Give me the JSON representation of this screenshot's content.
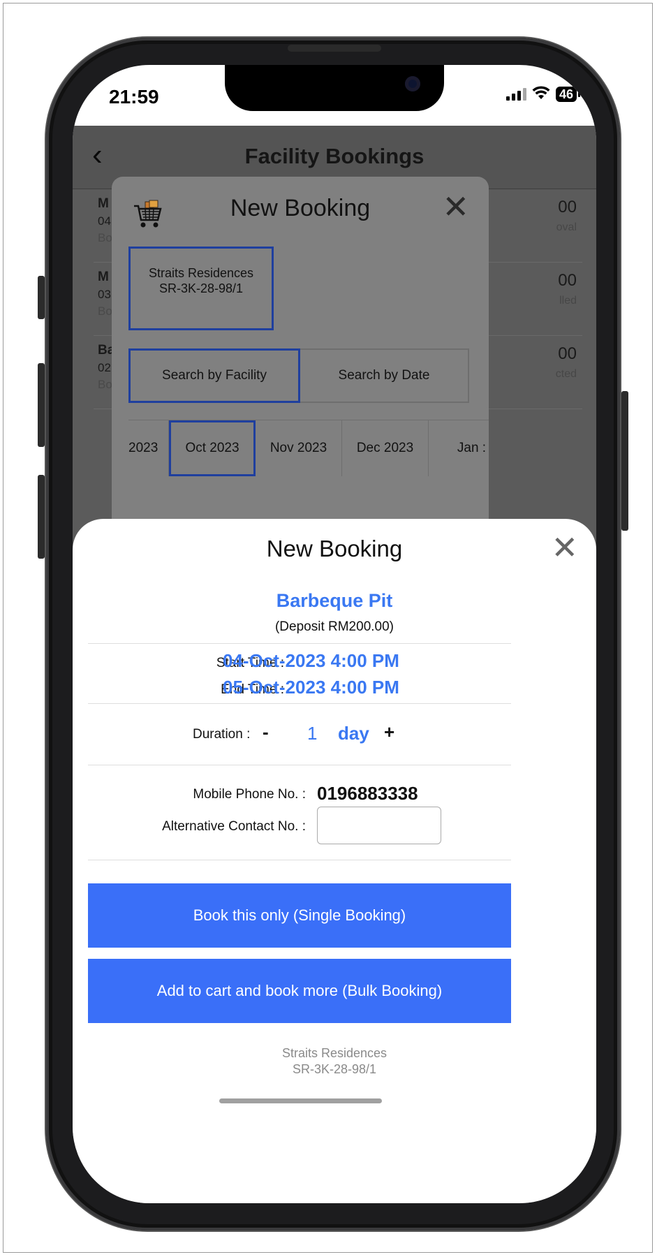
{
  "status_bar": {
    "time": "21:59",
    "battery": "46"
  },
  "header": {
    "title": "Facility Bookings"
  },
  "background_list": [
    {
      "line1": "M",
      "line2": "04",
      "line3": "Bo",
      "amount": "00",
      "status": "oval"
    },
    {
      "line1": "M",
      "line2": "03",
      "line3": "Bo",
      "amount": "00",
      "status": "lled"
    },
    {
      "line1": "Ba",
      "line2": "02",
      "line3": "Bo",
      "amount": "00",
      "status": "cted"
    }
  ],
  "bg_modal": {
    "title": "New Booking",
    "unit_line1": "Straits Residences",
    "unit_line2": "SR-3K-28-98/1",
    "tab_facility": "Search by Facility",
    "tab_date": "Search by Date",
    "months": [
      "2023",
      "Oct 2023",
      "Nov 2023",
      "Dec 2023",
      "Jan :"
    ]
  },
  "sheet": {
    "title": "New Booking",
    "facility": "Barbeque Pit",
    "deposit": "(Deposit RM200.00)",
    "start_label": "Start Time :",
    "start_value": "04-Oct-2023 4:00 PM",
    "end_label": "End Time :",
    "end_value": "05-Oct-2023 4:00 PM",
    "duration_label": "Duration :",
    "duration_minus": "-",
    "duration_value": "1",
    "duration_unit": "day",
    "duration_plus": "+",
    "mobile_label": "Mobile Phone No. :",
    "mobile_value": "0196883338",
    "alt_label": "Alternative Contact No. :",
    "alt_value": "",
    "single_button": "Book this only (Single Booking)",
    "bulk_button": "Add to cart and book more (Bulk Booking)",
    "footer_line1": "Straits Residences",
    "footer_line2": "SR-3K-28-98/1"
  },
  "colors": {
    "accent": "#3a78f2",
    "button": "#3a6ff8",
    "selected_border": "#1f3f9e"
  }
}
